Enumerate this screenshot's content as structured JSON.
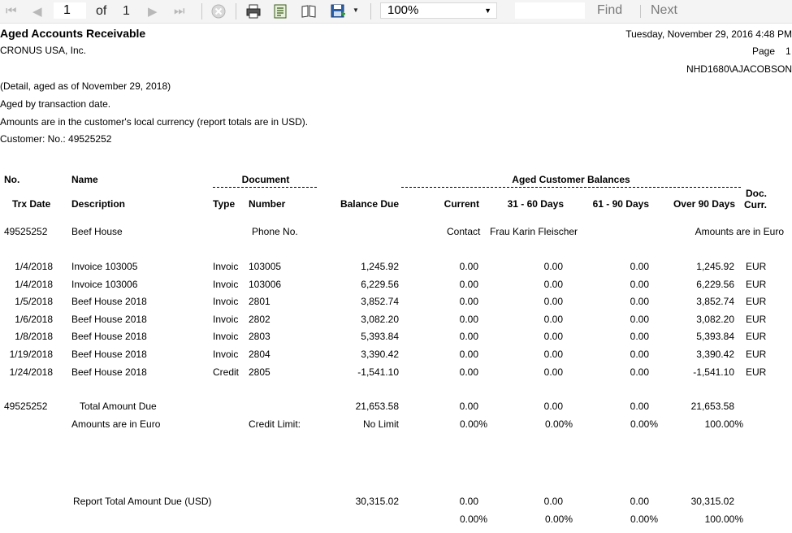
{
  "toolbar": {
    "page_current": "1",
    "page_of_label": "of",
    "page_total": "1",
    "zoom_value": "100%",
    "find_label": "Find",
    "next_label": "Next"
  },
  "report": {
    "title": "Aged Accounts Receivable",
    "company": "CRONUS USA, Inc.",
    "run_datetime": "Tuesday, November 29, 2016 4:48 PM",
    "page_label": "Page",
    "page_number": "1",
    "user": "NHD1680\\AJACOBSON",
    "filter_lines": [
      "(Detail, aged as of November 29, 2018)",
      "Aged by  transaction date.",
      "Amounts are in the customer's local currency (report totals are in USD).",
      "Customer: No.: 49525252"
    ],
    "headers": {
      "no": "No.",
      "name": "Name",
      "document": "Document",
      "aged_balances": "Aged Customer Balances",
      "trx_date": "Trx Date",
      "description": "Description",
      "type": "Type",
      "number": "Number",
      "balance_due": "Balance Due",
      "current": "Current",
      "d31_60": "31 - 60 Days",
      "d61_90": "61 - 90 Days",
      "over90": "Over 90 Days",
      "doc_curr_1": "Doc.",
      "doc_curr_2": "Curr."
    },
    "customer": {
      "no": "49525252",
      "name": "Beef House",
      "phone_label": "Phone No.",
      "contact_label": "Contact",
      "contact_name": "Frau Karin Fleischer",
      "currency_note": "Amounts are in Euro"
    },
    "rows": [
      {
        "date": "1/4/2018",
        "desc": "Invoice 103005",
        "type": "Invoic",
        "number": "103005",
        "balance": "1,245.92",
        "current": "0.00",
        "d31": "0.00",
        "d61": "0.00",
        "over90": "1,245.92",
        "curr": "EUR"
      },
      {
        "date": "1/4/2018",
        "desc": "Invoice 103006",
        "type": "Invoic",
        "number": "103006",
        "balance": "6,229.56",
        "current": "0.00",
        "d31": "0.00",
        "d61": "0.00",
        "over90": "6,229.56",
        "curr": "EUR"
      },
      {
        "date": "1/5/2018",
        "desc": "Beef House 2018",
        "type": "Invoic",
        "number": "2801",
        "balance": "3,852.74",
        "current": "0.00",
        "d31": "0.00",
        "d61": "0.00",
        "over90": "3,852.74",
        "curr": "EUR"
      },
      {
        "date": "1/6/2018",
        "desc": "Beef House 2018",
        "type": "Invoic",
        "number": "2802",
        "balance": "3,082.20",
        "current": "0.00",
        "d31": "0.00",
        "d61": "0.00",
        "over90": "3,082.20",
        "curr": "EUR"
      },
      {
        "date": "1/8/2018",
        "desc": "Beef House 2018",
        "type": "Invoic",
        "number": "2803",
        "balance": "5,393.84",
        "current": "0.00",
        "d31": "0.00",
        "d61": "0.00",
        "over90": "5,393.84",
        "curr": "EUR"
      },
      {
        "date": "1/19/2018",
        "desc": "Beef House 2018",
        "type": "Invoic",
        "number": "2804",
        "balance": "3,390.42",
        "current": "0.00",
        "d31": "0.00",
        "d61": "0.00",
        "over90": "3,390.42",
        "curr": "EUR"
      },
      {
        "date": "1/24/2018",
        "desc": "Beef House 2018",
        "type": "Credit",
        "number": "2805",
        "balance": "-1,541.10",
        "current": "0.00",
        "d31": "0.00",
        "d61": "0.00",
        "over90": "-1,541.10",
        "curr": "EUR"
      }
    ],
    "customer_total": {
      "no": "49525252",
      "label": "Total Amount Due",
      "balance": "21,653.58",
      "current": "0.00",
      "d31": "0.00",
      "d61": "0.00",
      "over90": "21,653.58",
      "currency_note": "Amounts are in Euro",
      "credit_limit_label": "Credit Limit:",
      "credit_limit_value": "No Limit",
      "pct_current": "0.00%",
      "pct_d31": "0.00%",
      "pct_d61": "0.00%",
      "pct_over90": "100.00%"
    },
    "report_total": {
      "label": "Report Total Amount Due (USD)",
      "balance": "30,315.02",
      "current": "0.00",
      "d31": "0.00",
      "d61": "0.00",
      "over90": "30,315.02",
      "pct_current": "0.00%",
      "pct_d31": "0.00%",
      "pct_d61": "0.00%",
      "pct_over90": "100.00%"
    }
  }
}
